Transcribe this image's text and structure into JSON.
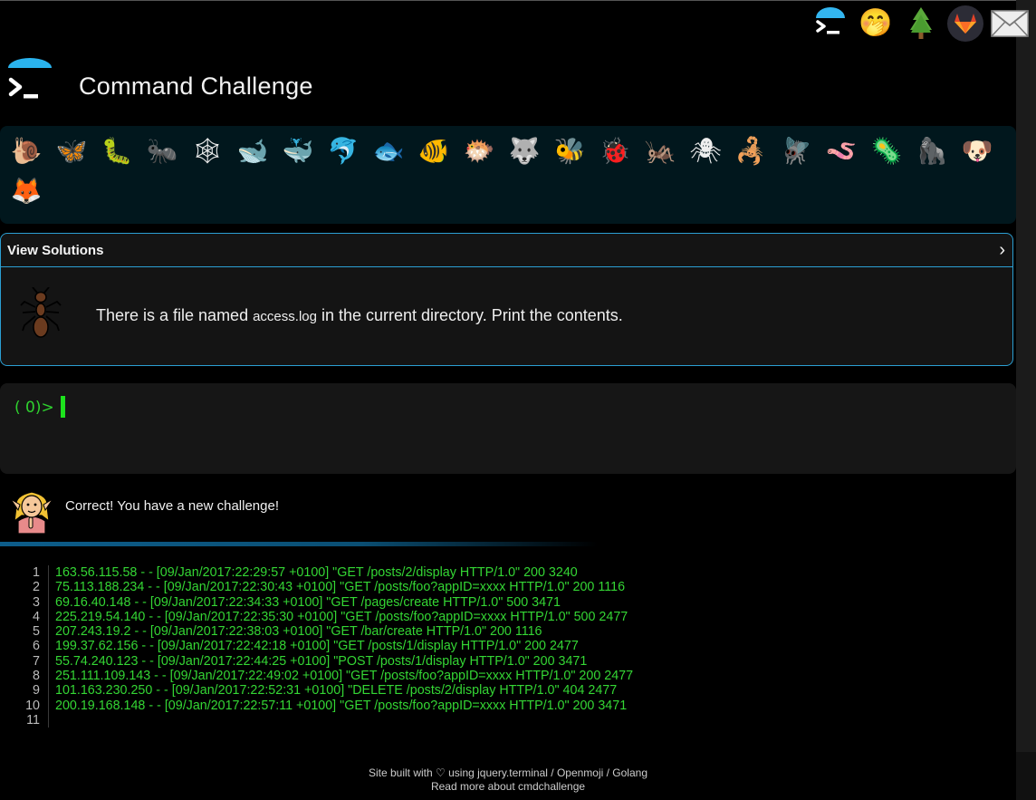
{
  "app": {
    "title": "Command Challenge"
  },
  "top_nav": {
    "icons": [
      "terminal-icon",
      "shushing-face-icon",
      "tree-icon",
      "gitlab-icon",
      "mail-icon"
    ]
  },
  "emoji_bar": {
    "items": [
      {
        "name": "snail-icon",
        "glyph": "🐌"
      },
      {
        "name": "butterfly-icon",
        "glyph": "🦋"
      },
      {
        "name": "caterpillar-icon",
        "glyph": "🐛"
      },
      {
        "name": "ant-icon",
        "glyph": "🐜"
      },
      {
        "name": "spider-web-icon",
        "glyph": "🕸"
      },
      {
        "name": "whale-icon",
        "glyph": "🐋"
      },
      {
        "name": "spouting-whale-icon",
        "glyph": "🐳"
      },
      {
        "name": "dolphin-icon",
        "glyph": "🐬"
      },
      {
        "name": "fish-icon",
        "glyph": "🐟"
      },
      {
        "name": "tropical-fish-icon",
        "glyph": "🐠"
      },
      {
        "name": "blowfish-icon",
        "glyph": "🐡"
      },
      {
        "name": "wolf-icon",
        "glyph": "🐺"
      },
      {
        "name": "bee-icon",
        "glyph": "🐝"
      },
      {
        "name": "ladybug-icon",
        "glyph": "🐞"
      },
      {
        "name": "cricket-icon",
        "glyph": "🦗"
      },
      {
        "name": "spider-icon",
        "glyph": "🕷"
      },
      {
        "name": "scorpion-icon",
        "glyph": "🦂"
      },
      {
        "name": "fly-icon",
        "glyph": "🪰"
      },
      {
        "name": "worm-icon",
        "glyph": "🪱"
      },
      {
        "name": "microbe-icon",
        "glyph": "🦠"
      },
      {
        "name": "gorilla-icon",
        "glyph": "🦍"
      },
      {
        "name": "dog-icon",
        "glyph": "🐶"
      },
      {
        "name": "fox-icon",
        "glyph": "🦊"
      }
    ]
  },
  "challenge": {
    "view_solutions": "View Solutions",
    "chevron": "›",
    "text_before": "There is a file named ",
    "filename": "access.log",
    "text_after": " in the current directory. Print the contents."
  },
  "terminal": {
    "prompt": "( 0)>"
  },
  "feedback": {
    "message": "Correct! You have a new challenge!"
  },
  "output": {
    "lines": [
      "163.56.115.58 - - [09/Jan/2017:22:29:57 +0100] \"GET /posts/2/display HTTP/1.0\" 200 3240",
      "75.113.188.234 - - [09/Jan/2017:22:30:43 +0100] \"GET /posts/foo?appID=xxxx HTTP/1.0\" 200 1116",
      "69.16.40.148 - - [09/Jan/2017:22:34:33 +0100] \"GET /pages/create HTTP/1.0\" 500 3471",
      "225.219.54.140 - - [09/Jan/2017:22:35:30 +0100] \"GET /posts/foo?appID=xxxx HTTP/1.0\" 500 2477",
      "207.243.19.2 - - [09/Jan/2017:22:38:03 +0100] \"GET /bar/create HTTP/1.0\" 200 1116",
      "199.37.62.156 - - [09/Jan/2017:22:42:18 +0100] \"GET /posts/1/display HTTP/1.0\" 200 2477",
      "55.74.240.123 - - [09/Jan/2017:22:44:25 +0100] \"POST /posts/1/display HTTP/1.0\" 200 3471",
      "251.111.109.143 - - [09/Jan/2017:22:49:02 +0100] \"GET /posts/foo?appID=xxxx HTTP/1.0\" 200 2477",
      "101.163.230.250 - - [09/Jan/2017:22:52:31 +0100] \"DELETE /posts/2/display HTTP/1.0\" 404 2477",
      "200.19.168.148 - - [09/Jan/2017:22:57:11 +0100] \"GET /posts/foo?appID=xxxx HTTP/1.0\" 200 3471",
      ""
    ]
  },
  "footer": {
    "credits": "Site built with ♡ using jquery.terminal / Openmoji / Golang",
    "read_more": "Read more about cmdchallenge"
  },
  "colors": {
    "accent": "#2b9fd3",
    "terminal_green": "#34d634",
    "emoji_bar_bg": "#01171d"
  }
}
